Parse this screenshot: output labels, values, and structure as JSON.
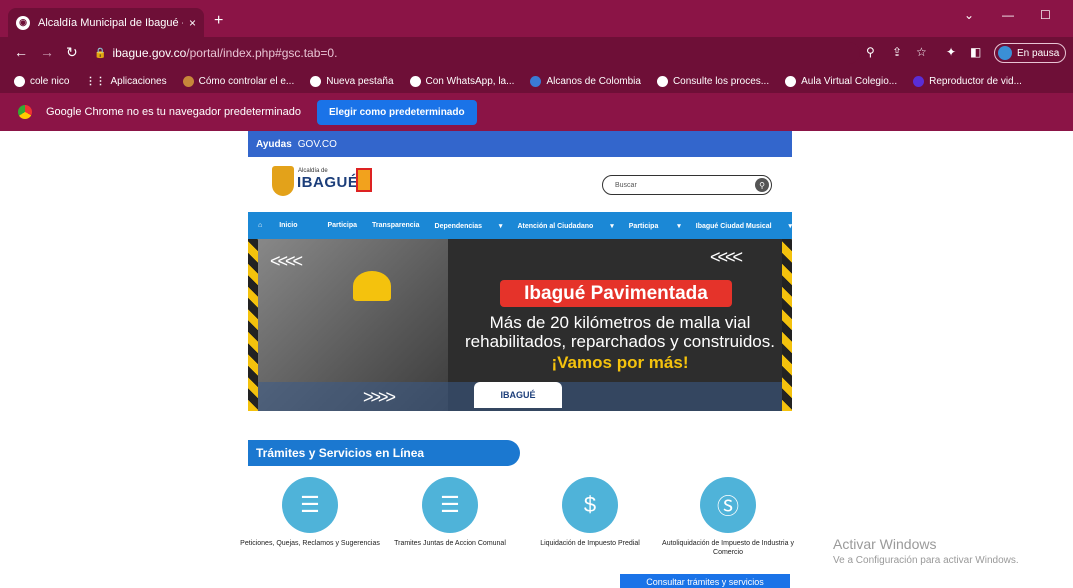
{
  "browser": {
    "tab_title": "Alcaldía Municipal de Ibagué - Ib",
    "tab_close": "×",
    "new_tab": "+",
    "url_host": "ibague.gov.co",
    "url_path": "/portal/index.php#gsc.tab=0.",
    "profile_label": "En pausa",
    "bookmarks": [
      "cole nico",
      "Aplicaciones",
      "Cómo controlar el e...",
      "Nueva pestaña",
      "Con WhatsApp, la...",
      "Alcanos de Colombia",
      "Consulte los proces...",
      "Aula Virtual Colegio...",
      "Reproductor de vid..."
    ],
    "infobar_text": "Google Chrome no es tu navegador predeterminado",
    "infobar_button": "Elegir como predeterminado"
  },
  "site": {
    "gov_bar_label": "Ayudas",
    "gov_bar_logo": "GOV.CO",
    "logo_small": "Alcaldía de",
    "logo_big": "IBAGUÉ",
    "search_placeholder": "Buscar",
    "menu": [
      "Inicio",
      "Participa",
      "Transparencia",
      "Dependencias",
      "Atención al Ciudadano",
      "Participa",
      "Ibagué Ciudad Musical"
    ],
    "banner": {
      "title": "Ibagué Pavimentada",
      "line1": "Más de 20 kilómetros de malla vial",
      "line2": "rehabilitados, reparchados y construidos.",
      "cta": "¡Vamos por más!",
      "logo": "IBAGUÉ"
    },
    "section_title": "Trámites y Servicios en Línea",
    "services": [
      {
        "label": "Peticiones, Quejas, Reclamos y Sugerencias",
        "icon": "list-icon"
      },
      {
        "label": "Tramites Juntas de Accion Comunal",
        "icon": "list-icon"
      },
      {
        "label": "Liquidación de Impuesto Predial",
        "icon": "hand-money-icon"
      },
      {
        "label": "Autoliquidación de Impuesto de Industria y Comercio",
        "icon": "coin-icon"
      }
    ],
    "consult_button": "Consultar trámites y servicios"
  },
  "watermark": {
    "title": "Activar Windows",
    "subtitle": "Ve a Configuración para activar Windows."
  }
}
